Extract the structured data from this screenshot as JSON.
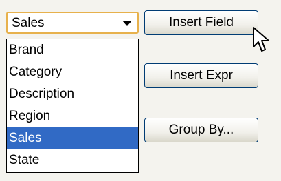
{
  "field_select": {
    "value": "Sales",
    "options": [
      "Brand",
      "Category",
      "Description",
      "Region",
      "Sales",
      "State"
    ],
    "selected_option": "Sales"
  },
  "buttons": {
    "insert_field": "Insert Field",
    "insert_expr": "Insert Expr",
    "group_by": "Group By..."
  },
  "colors": {
    "selection": "#316ac5",
    "focus_border": "#e7b14c",
    "button_border": "#003c74",
    "background": "#f4f3ee"
  },
  "icons": {
    "combo_arrow": "chevron-down-icon",
    "pointer": "mouse-pointer-icon"
  }
}
